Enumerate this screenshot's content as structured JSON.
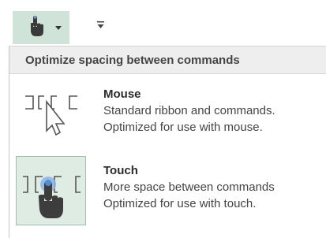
{
  "toolbar": {
    "touch_mode_button": {
      "icon": "touch-mouse-mode-icon",
      "accent": "#cfe3d8"
    },
    "dropdown_caret": {
      "icon": "chevron-down-icon"
    },
    "customize_button": {
      "icon": "customize-qat-icon"
    }
  },
  "menu": {
    "header": "Optimize spacing between commands",
    "items": [
      {
        "title": "Mouse",
        "line1": "Standard ribbon and commands.",
        "line2": "Optimized for use with mouse.",
        "icon": "mouse-pointer-spacing-icon",
        "selected": false
      },
      {
        "title": "Touch",
        "line1": "More space between commands",
        "line2": "Optimized for use with touch.",
        "icon": "touch-finger-spacing-icon",
        "selected": true
      }
    ]
  },
  "colors": {
    "selected_background": "#dfece3",
    "selected_border": "#9fbfa9",
    "header_background": "#eeeeee",
    "icon_stroke": "#555555",
    "finger_dark": "#3d3d3d",
    "touch_point_blue": "#4a90d9"
  }
}
